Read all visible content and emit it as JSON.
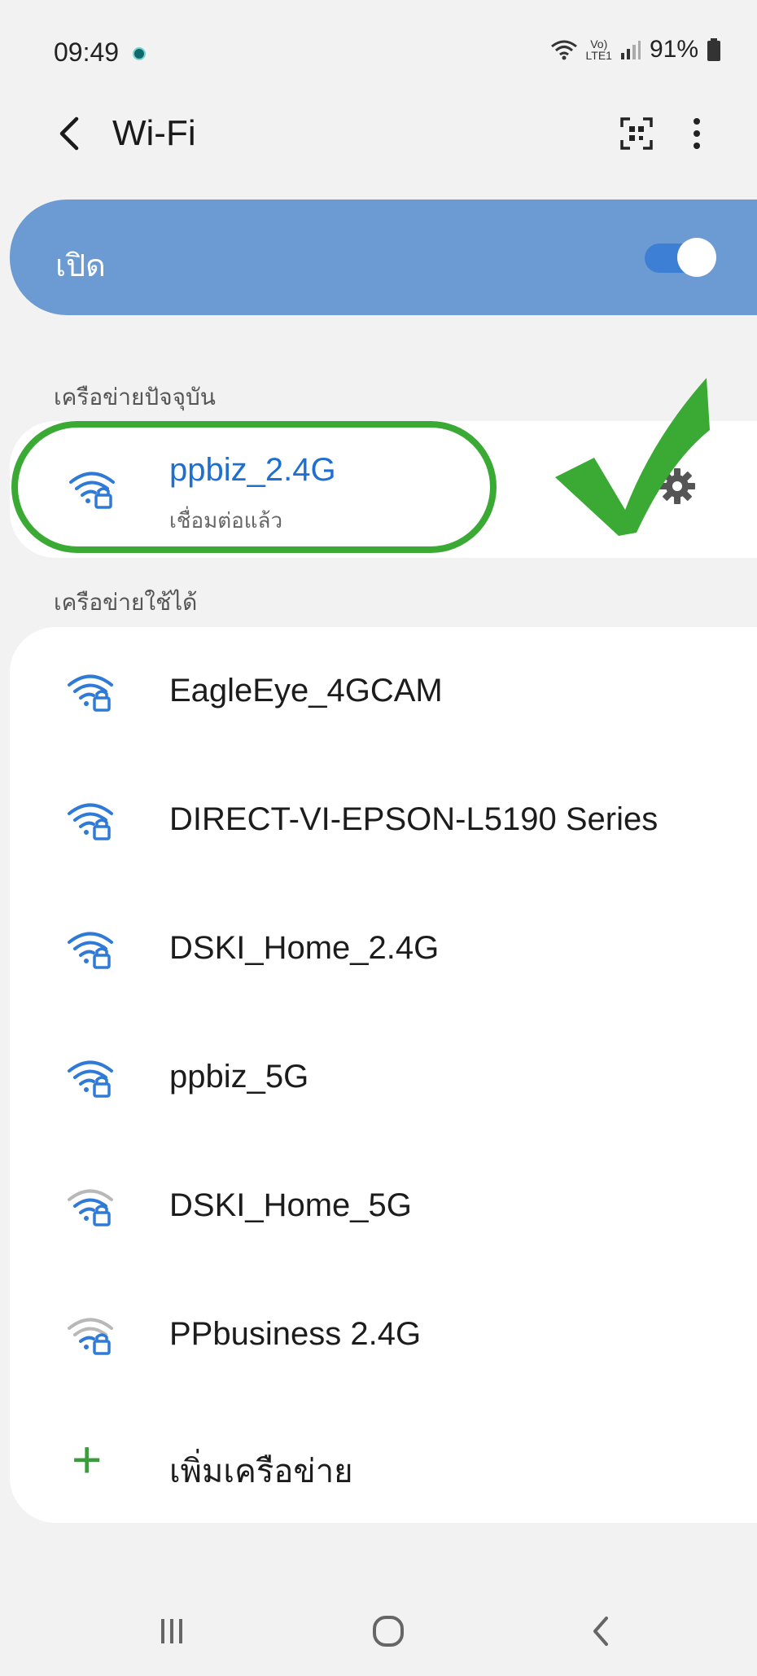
{
  "status_bar": {
    "time": "09:49",
    "volte_top": "Vo)",
    "volte_bottom": "LTE1",
    "battery_percent": "91%"
  },
  "header": {
    "title": "Wi-Fi",
    "back_icon": "chevron-left-icon",
    "qr_icon": "qr-scan-icon",
    "more_icon": "more-vertical-icon"
  },
  "master_switch": {
    "label": "เปิด",
    "on": true,
    "accent": "#3e7fd6"
  },
  "current_network": {
    "section_label": "เครือข่ายปัจจุบัน",
    "name": "ppbiz_2.4G",
    "status": "เชื่อมต่อแล้ว",
    "icon": "wifi-lock-icon",
    "settings_icon": "gear-icon"
  },
  "available_networks": {
    "section_label": "เครือข่ายใช้ได้",
    "items": [
      {
        "name": "EagleEye_4GCAM",
        "signal": "full"
      },
      {
        "name": "DIRECT-VI-EPSON-L5190 Series",
        "signal": "full"
      },
      {
        "name": "DSKI_Home_2.4G",
        "signal": "full"
      },
      {
        "name": "ppbiz_5G",
        "signal": "full"
      },
      {
        "name": "DSKI_Home_5G",
        "signal": "weak"
      },
      {
        "name": "PPbusiness 2.4G",
        "signal": "weak"
      }
    ],
    "add_label": "เพิ่มเครือข่าย"
  },
  "annotation": {
    "highlight_color": "#3aaa35"
  },
  "nav_bar": {
    "recents_icon": "recents-icon",
    "home_icon": "home-icon",
    "back_icon": "back-icon"
  }
}
